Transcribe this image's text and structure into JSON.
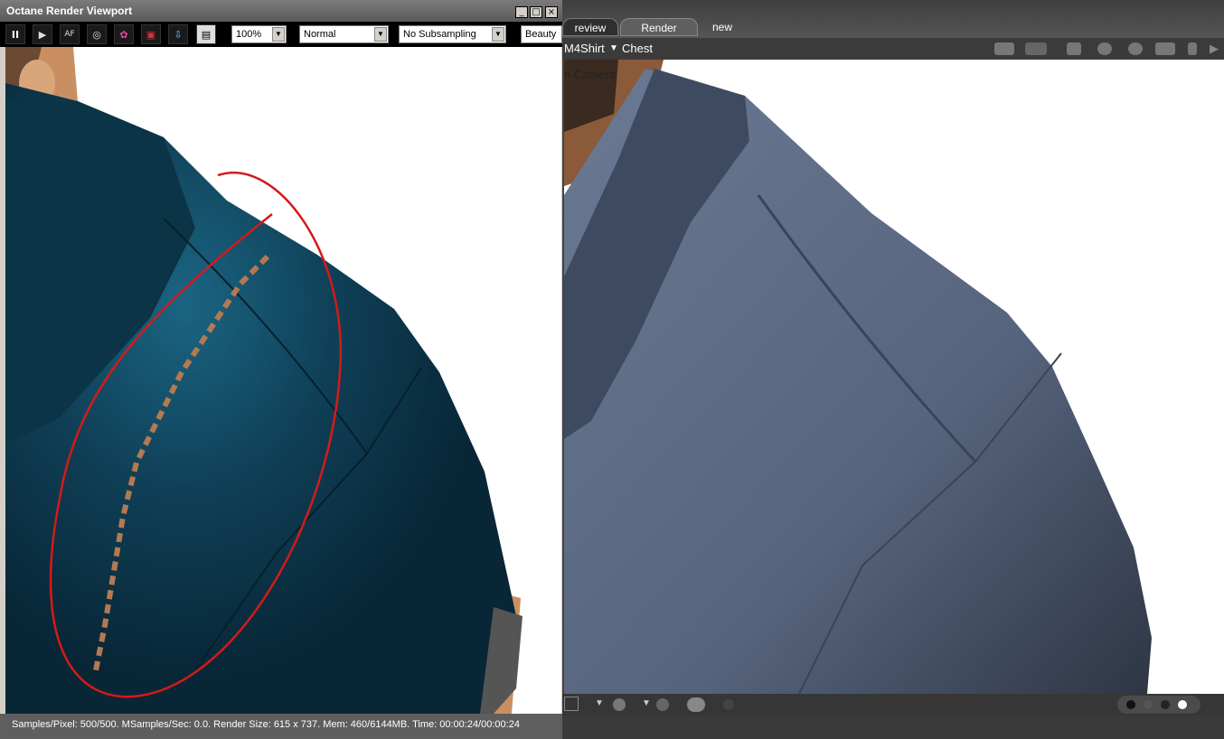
{
  "octane": {
    "title": "Octane Render Viewport",
    "window_buttons": [
      "_",
      "□",
      "×"
    ],
    "toolbar": {
      "buttons": [
        {
          "icon": "pause-icon",
          "label": "II"
        },
        {
          "icon": "play-icon",
          "label": "▶"
        },
        {
          "icon": "autofocus-icon",
          "label": "AF"
        },
        {
          "icon": "camera-lens-icon",
          "label": "◎"
        },
        {
          "icon": "color-picker-icon",
          "label": "✿"
        },
        {
          "icon": "region-render-icon",
          "label": "▣"
        },
        {
          "icon": "export-icon",
          "label": "⇩"
        },
        {
          "icon": "document-icon",
          "label": "▤"
        }
      ],
      "zoom": "100%",
      "tonemap": "Normal",
      "subsampling": "No Subsampling",
      "pass": "Beauty"
    },
    "status": "Samples/Pixel: 500/500. MSamples/Sec: 0.0. Render Size: 615 x 737. Mem: 460/6144MB. Time: 00:00:24/00:00:24"
  },
  "daz": {
    "tabs": [
      "review",
      "Render",
      "new"
    ],
    "scene": {
      "figure": "M4Shirt",
      "node": "Chest",
      "camera": "n Camera"
    },
    "camera_icons": [
      "camera-select-icon",
      "frame-icon",
      "focus-icon",
      "orbit-icon",
      "rotate-icon",
      "pan-icon",
      "dolly-icon",
      "arrow-right-icon"
    ],
    "bottom_icons": [
      "draw-style-icon",
      "light-icon",
      "sphere-icon",
      "spheres-icon"
    ],
    "footer_dots": [
      "#111111",
      "#555555",
      "#222222",
      "#ffffff"
    ]
  },
  "colors": {
    "octane_shirt": "#0e3d52",
    "daz_shirt": "#5b6a84",
    "annotation": "#d41a1a",
    "background": "#ffffff"
  }
}
